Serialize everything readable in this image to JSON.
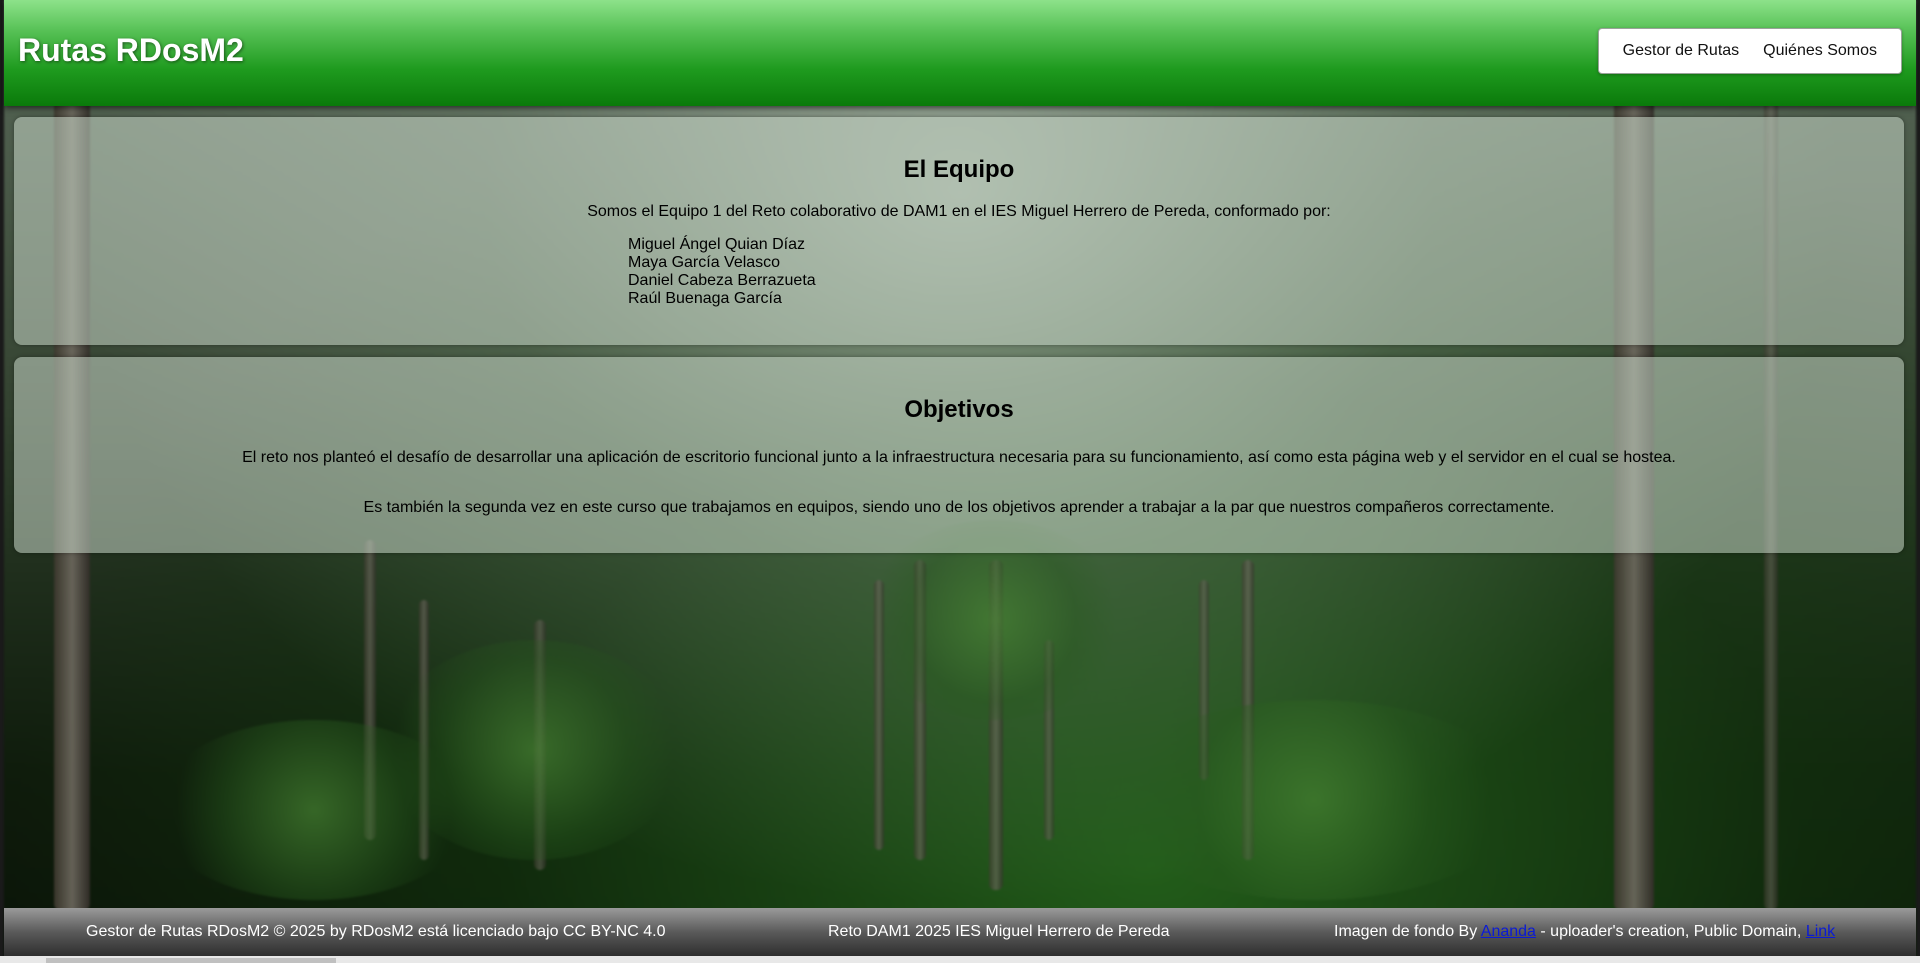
{
  "header": {
    "brand": "Rutas RDosM2",
    "nav": [
      {
        "label": "Gestor de Rutas"
      },
      {
        "label": "Quiénes Somos"
      }
    ]
  },
  "team": {
    "title": "El Equipo",
    "intro": "Somos el Equipo 1 del Reto colaborativo de DAM1 en el IES Miguel Herrero de Pereda, conformado por:",
    "members": [
      "Miguel Ángel Quian Díaz",
      "Maya García Velasco",
      "Daniel Cabeza Berrazueta",
      "Raúl Buenaga García"
    ]
  },
  "objectives": {
    "title": "Objetivos",
    "paragraph1": "El reto nos planteó el desafío de desarrollar una aplicación de escritorio funcional junto a la infraestructura necesaria para su funcionamiento, así como esta página web y el servidor en el cual se hostea.",
    "paragraph2": "Es también la segunda vez en este curso que trabajamos en equipos, siendo uno de los objetivos aprender a trabajar a la par que nuestros compañeros correctamente."
  },
  "footer": {
    "license": "Gestor de Rutas RDosM2 © 2025 by RDosM2 está licenciado bajo CC BY-NC 4.0",
    "center": "Reto DAM1 2025 IES Miguel Herrero de Pereda",
    "credit_prefix": "Imagen de fondo By ",
    "author_link": "Ananda",
    "credit_middle": " - uploader's creation, Public Domain, ",
    "link_label": "Link"
  },
  "colors": {
    "header_top": "#8de28a",
    "header_bottom": "#0a7a0a",
    "footer": "#5a5a5a",
    "link": "#0b1bd6"
  }
}
